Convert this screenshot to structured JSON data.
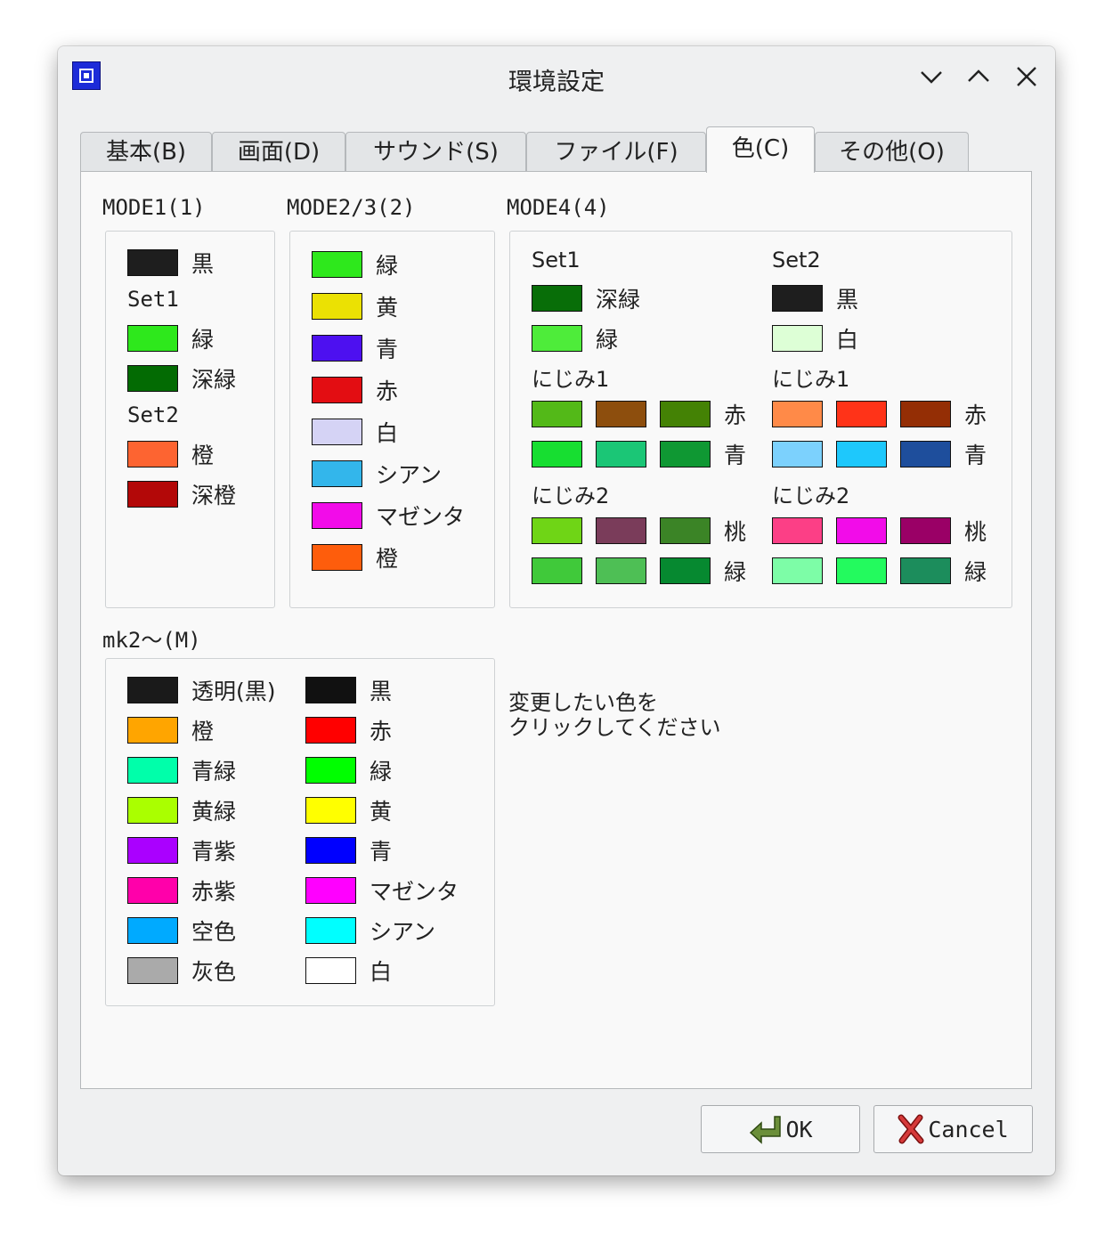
{
  "window": {
    "title": "環境設定"
  },
  "tabs": [
    "基本(B)",
    "画面(D)",
    "サウンド(S)",
    "ファイル(F)",
    "色(C)",
    "その他(O)"
  ],
  "mode1": {
    "label": "MODE1(1)",
    "top": [
      {
        "color": "#1e1e1e",
        "label": "黒"
      }
    ],
    "set1_label": "Set1",
    "set1": [
      {
        "color": "#2ee81c",
        "label": "緑"
      },
      {
        "color": "#036b03",
        "label": "深緑"
      }
    ],
    "set2_label": "Set2",
    "set2": [
      {
        "color": "#fd6431",
        "label": "橙"
      },
      {
        "color": "#b30808",
        "label": "深橙"
      }
    ]
  },
  "mode23": {
    "label": "MODE2/3(2)",
    "items": [
      {
        "color": "#2ee81c",
        "label": "緑"
      },
      {
        "color": "#ebe103",
        "label": "黄"
      },
      {
        "color": "#4d10f0",
        "label": "青"
      },
      {
        "color": "#e30d12",
        "label": "赤"
      },
      {
        "color": "#d5d3f5",
        "label": "白"
      },
      {
        "color": "#33b6eb",
        "label": "シアン"
      },
      {
        "color": "#f20ce9",
        "label": "マゼンタ"
      },
      {
        "color": "#fe5d0c",
        "label": "橙"
      }
    ]
  },
  "mode4": {
    "label": "MODE4(4)",
    "set1": {
      "label": "Set1",
      "items": [
        {
          "color": "#086e08",
          "label": "深緑"
        },
        {
          "color": "#4eec3a",
          "label": "緑"
        }
      ],
      "nijimi1_label": "にじみ1",
      "nijimi1": [
        {
          "colors": [
            "#53b918",
            "#8d4e0d",
            "#448205"
          ],
          "label": "赤"
        },
        {
          "colors": [
            "#17de31",
            "#1bc676",
            "#0f9833"
          ],
          "label": "青"
        }
      ],
      "nijimi2_label": "にじみ2",
      "nijimi2": [
        {
          "colors": [
            "#6fd516",
            "#7a3c5a",
            "#3b8426"
          ],
          "label": "桃"
        },
        {
          "colors": [
            "#40c93a",
            "#4ebf55",
            "#068930"
          ],
          "label": "緑"
        }
      ]
    },
    "set2": {
      "label": "Set2",
      "items": [
        {
          "color": "#1e1e1e",
          "label": "黒"
        },
        {
          "color": "#ddffd6",
          "label": "白"
        }
      ],
      "nijimi1_label": "にじみ1",
      "nijimi1": [
        {
          "colors": [
            "#ff8a48",
            "#ff3318",
            "#942e05"
          ],
          "label": "赤"
        },
        {
          "colors": [
            "#7cd1fd",
            "#1ec8fc",
            "#1e4e9c"
          ],
          "label": "青"
        }
      ],
      "nijimi2_label": "にじみ2",
      "nijimi2": [
        {
          "colors": [
            "#fc3f86",
            "#f20ce9",
            "#9a0066"
          ],
          "label": "桃"
        },
        {
          "colors": [
            "#7dfda7",
            "#23fa5e",
            "#1c8d5c"
          ],
          "label": "緑"
        }
      ]
    }
  },
  "mk2": {
    "label": "mk2〜(M)",
    "left": [
      {
        "color": "#1a1a1a",
        "label": "透明(黒)"
      },
      {
        "color": "#ffa500",
        "label": "橙"
      },
      {
        "color": "#00ffaa",
        "label": "青緑"
      },
      {
        "color": "#aaff00",
        "label": "黄緑"
      },
      {
        "color": "#aa00ff",
        "label": "青紫"
      },
      {
        "color": "#ff00aa",
        "label": "赤紫"
      },
      {
        "color": "#00aaff",
        "label": "空色"
      },
      {
        "color": "#aaaaaa",
        "label": "灰色"
      }
    ],
    "right": [
      {
        "color": "#111111",
        "label": "黒"
      },
      {
        "color": "#ff0000",
        "label": "赤"
      },
      {
        "color": "#00ff00",
        "label": "緑"
      },
      {
        "color": "#ffff00",
        "label": "黄"
      },
      {
        "color": "#0000ff",
        "label": "青"
      },
      {
        "color": "#ff00ff",
        "label": "マゼンタ"
      },
      {
        "color": "#00ffff",
        "label": "シアン"
      },
      {
        "color": "#ffffff",
        "label": "白"
      }
    ]
  },
  "hint": [
    "変更したい色を",
    "クリックしてください"
  ],
  "buttons": {
    "ok": "OK",
    "cancel": "Cancel"
  }
}
